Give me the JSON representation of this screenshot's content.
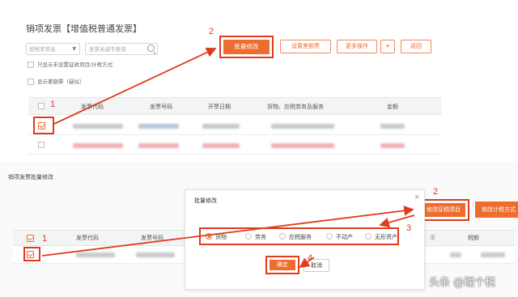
{
  "top_panel": {
    "title": "销项发票【增值税普通发票】",
    "filter_select": "按税率筛选",
    "search_placeholder": "发票关键字查询",
    "option_show_unset": "只显示未设置征收项目/计税方式",
    "option_show_diff": "显示差额票（疑似）",
    "buttons": {
      "batch_modify": "批量修改",
      "set_limit": "设置差额票",
      "more_ops": "更多操作",
      "dropdown": "▾",
      "back": "返回"
    },
    "table_headers": [
      "发票代码",
      "发票号码",
      "开票日期",
      "货物、应税劳务及服务",
      "金额"
    ]
  },
  "bottom_panel": {
    "title": "销项发票批量修改",
    "table_headers": [
      "发票代码",
      "发票号码",
      "率",
      "税额"
    ],
    "right_buttons": {
      "modify_tax_item": "修改征税项目",
      "modify_tax_method": "修改计税方式"
    },
    "modal": {
      "title": "批量修改",
      "close_symbol": "×",
      "radio_options": [
        "货物",
        "劳务",
        "应税服务",
        "不动产",
        "无形资产"
      ],
      "selected_option": "货物",
      "confirm_label": "确定",
      "cancel_label": "取消"
    }
  },
  "annotations": {
    "step_1": "1",
    "step_2": "2",
    "step_3": "3",
    "step_4": "4"
  },
  "watermark": "头条 @理个税",
  "colors": {
    "accent": "#ef6c2f",
    "highlight_red": "#e03b1d"
  }
}
